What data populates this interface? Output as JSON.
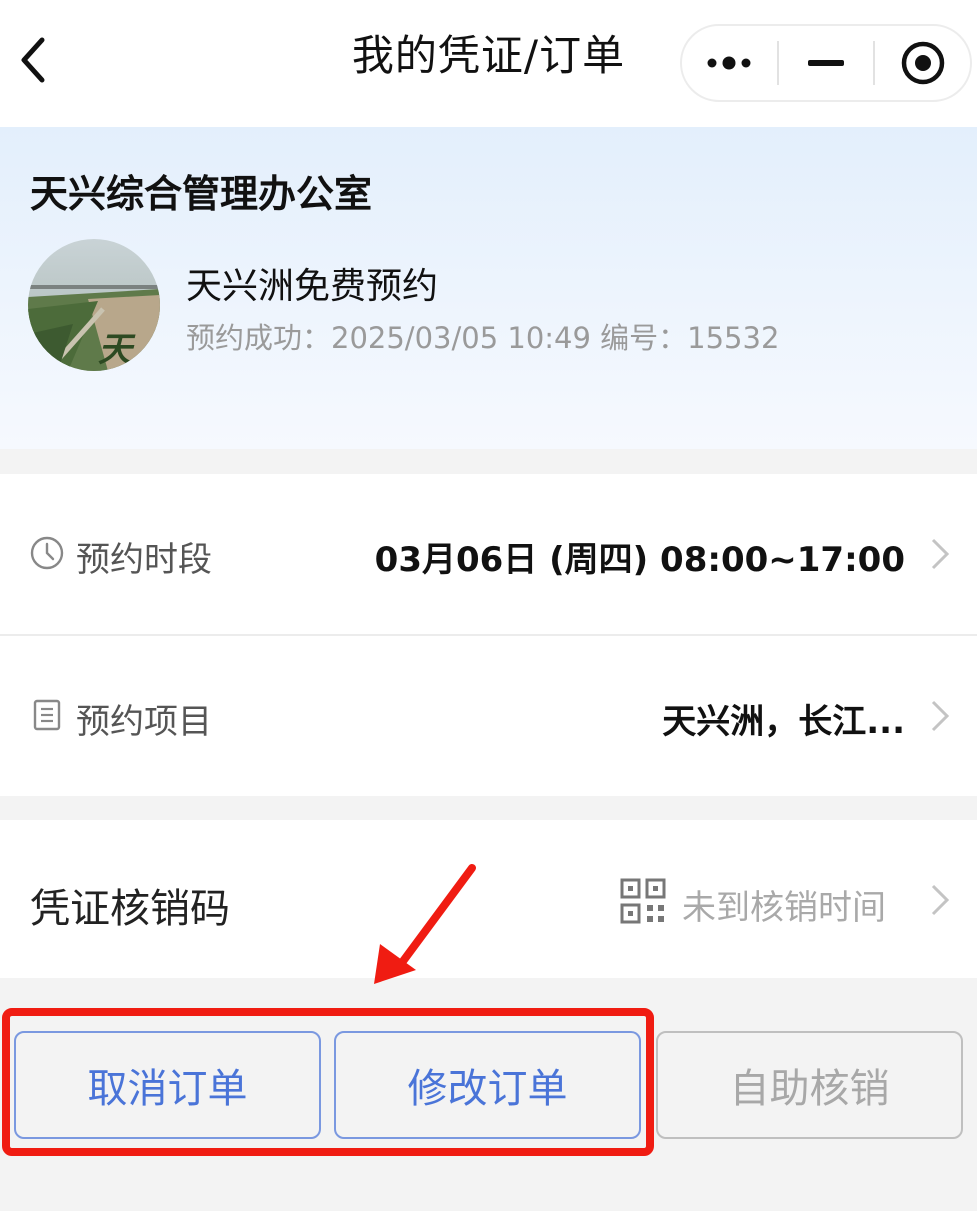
{
  "nav": {
    "title": "我的凭证/订单",
    "back_icon": "chevron-left-icon",
    "capsule_icons": [
      "more-dots-icon",
      "minimize-icon",
      "target-icon"
    ]
  },
  "header": {
    "org_name": "天兴综合管理办公室",
    "service_name": "天兴洲免费预约",
    "order_meta": "预约成功：2025/03/05 10:49  编号：15532"
  },
  "info": {
    "time_label": "预约时段",
    "time_value": "03月06日 (周四) 08:00~17:00",
    "item_label": "预约项目",
    "item_value": "天兴洲，长江..."
  },
  "code": {
    "title": "凭证核销码",
    "status": "未到核销时间"
  },
  "buttons": {
    "cancel": "取消订单",
    "modify": "修改订单",
    "self_verify": "自助核销"
  },
  "colors": {
    "accent_blue": "#4a74d8",
    "highlight_red": "#f01c12"
  }
}
